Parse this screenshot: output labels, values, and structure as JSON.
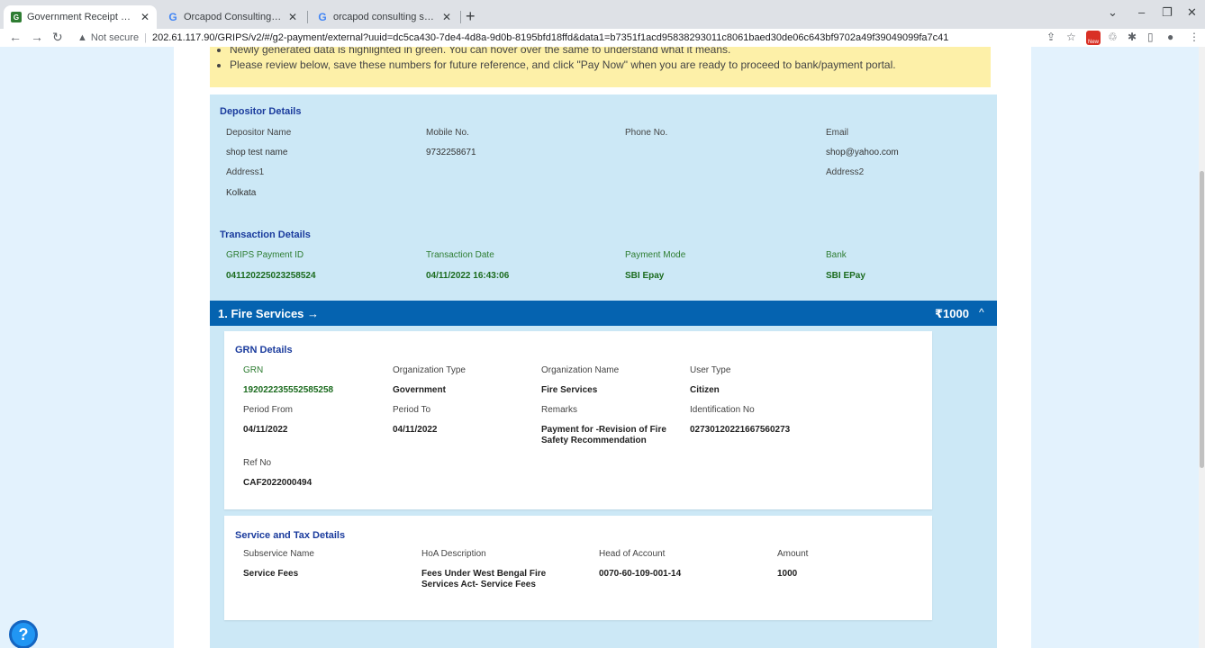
{
  "browser": {
    "tabs": [
      {
        "title": "Government Receipt Portal Syste",
        "favicon": "grips-favicon",
        "active": true
      },
      {
        "title": "Orcapod Consulting Services Pri",
        "favicon": "google-favicon",
        "active": false
      },
      {
        "title": "orcapod consulting services kolk",
        "favicon": "google-favicon",
        "active": false
      }
    ],
    "new_tab": "+",
    "security": "Not secure",
    "url": "202.61.117.90/GRIPS/v2/#/g2-payment/external?uuid=dc5ca430-7de4-4d8a-9d0b-8195bfd18ffd&data1=b7351f1acd95838293011c8061baed30de06c643bf9702a49f39049099fa7c41"
  },
  "notice": {
    "lines": [
      "Newly generated data is highlighted in green. You can hover over the same to understand what it means.",
      "Please review below, save these numbers for future reference, and click \"Pay Now\" when you are ready to proceed to bank/payment portal."
    ]
  },
  "depositor": {
    "title": "Depositor Details",
    "labels": {
      "name": "Depositor Name",
      "mobile": "Mobile No.",
      "phone": "Phone No.",
      "email": "Email"
    },
    "values": {
      "name": "shop test name",
      "mobile": "9732258671",
      "phone": "",
      "email": "shop@yahoo.com"
    },
    "address1_label": "Address1",
    "address2_label": "Address2",
    "address1": "Kolkata"
  },
  "transaction": {
    "title": "Transaction Details",
    "labels": {
      "id": "GRIPS Payment ID",
      "date": "Transaction Date",
      "mode": "Payment Mode",
      "bank": "Bank"
    },
    "values": {
      "id": "041120225023258524",
      "date": "04/11/2022 16:43:06",
      "mode": "SBI Epay",
      "bank": "SBI EPay"
    }
  },
  "service": {
    "title": "1. Fire Services →",
    "amount": "₹1000",
    "collapse_icon": "^"
  },
  "grn": {
    "title": "GRN Details",
    "labels": {
      "grn": "GRN",
      "org_type": "Organization Type",
      "org_name": "Organization Name",
      "user_type": "User Type",
      "period_from": "Period From",
      "period_to": "Period To",
      "remarks": "Remarks",
      "ident": "Identification No",
      "ref": "Ref No"
    },
    "values": {
      "grn": "192022235552585258",
      "org_type": "Government",
      "org_name": "Fire Services",
      "user_type": "Citizen",
      "period_from": "04/11/2022",
      "period_to": "04/11/2022",
      "remarks": "Payment for -Revision of Fire Safety Recommendation",
      "ident": "02730120221667560273",
      "ref": "CAF2022000494"
    }
  },
  "tax": {
    "title": "Service and Tax Details",
    "labels": {
      "subservice": "Subservice Name",
      "hoa": "HoA Description",
      "head": "Head of Account",
      "amount": "Amount"
    },
    "values": {
      "subservice": "Service Fees",
      "hoa": "Fees Under West Bengal Fire Services Act- Service Fees",
      "head": "0070-60-109-001-14",
      "amount": "1000"
    }
  },
  "help_icon": "?"
}
